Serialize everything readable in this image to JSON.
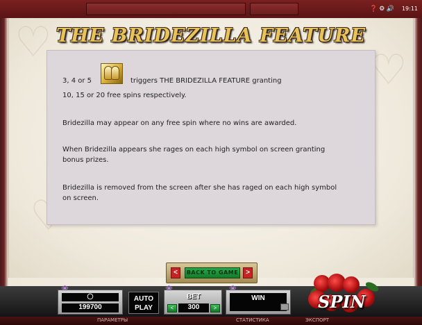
{
  "title": "THE BRIDEZILLA FEATURE",
  "status_bar": {
    "icons": "❓ ⚙ 🔊",
    "time": "19:11"
  },
  "info": {
    "line1_prefix": "3, 4 or 5",
    "line1_suffix": "triggers THE BRIDEZILLA FEATURE granting",
    "line1_cont": "10, 15 or 20 free spins respectively.",
    "line2": "Bridezilla may appear on any free spin where no wins are awarded.",
    "line3": "When Bridezilla appears she rages on each high symbol on screen granting bonus prizes.",
    "line4": "Bridezilla is removed from the screen after she has raged on each high symbol on screen.",
    "scatter_icon": "wedding-bells-icon"
  },
  "nav": {
    "prev": "<",
    "next": ">",
    "back_label": "BACK TO GAME"
  },
  "controls": {
    "credits_icon": "coin-icon",
    "credits_value": "199700",
    "autoplay_line1": "AUTO",
    "autoplay_line2": "PLAY",
    "bet_label": "BET",
    "bet_value": "300",
    "bet_dec": "<",
    "bet_inc": ">",
    "win_label": "WIN",
    "win_value": "",
    "spin_label": "SPIN"
  },
  "bottom_bar": {
    "params": "ПАРАМЕТРЫ",
    "stats": "СТАТИСТИКА",
    "extra": "ЭКСПОРТ"
  },
  "colors": {
    "title_gold": "#e8c25a",
    "panel_bg": "#ddd6da",
    "back_btn_green": "#2aa84a",
    "arrow_red": "#c62424"
  }
}
